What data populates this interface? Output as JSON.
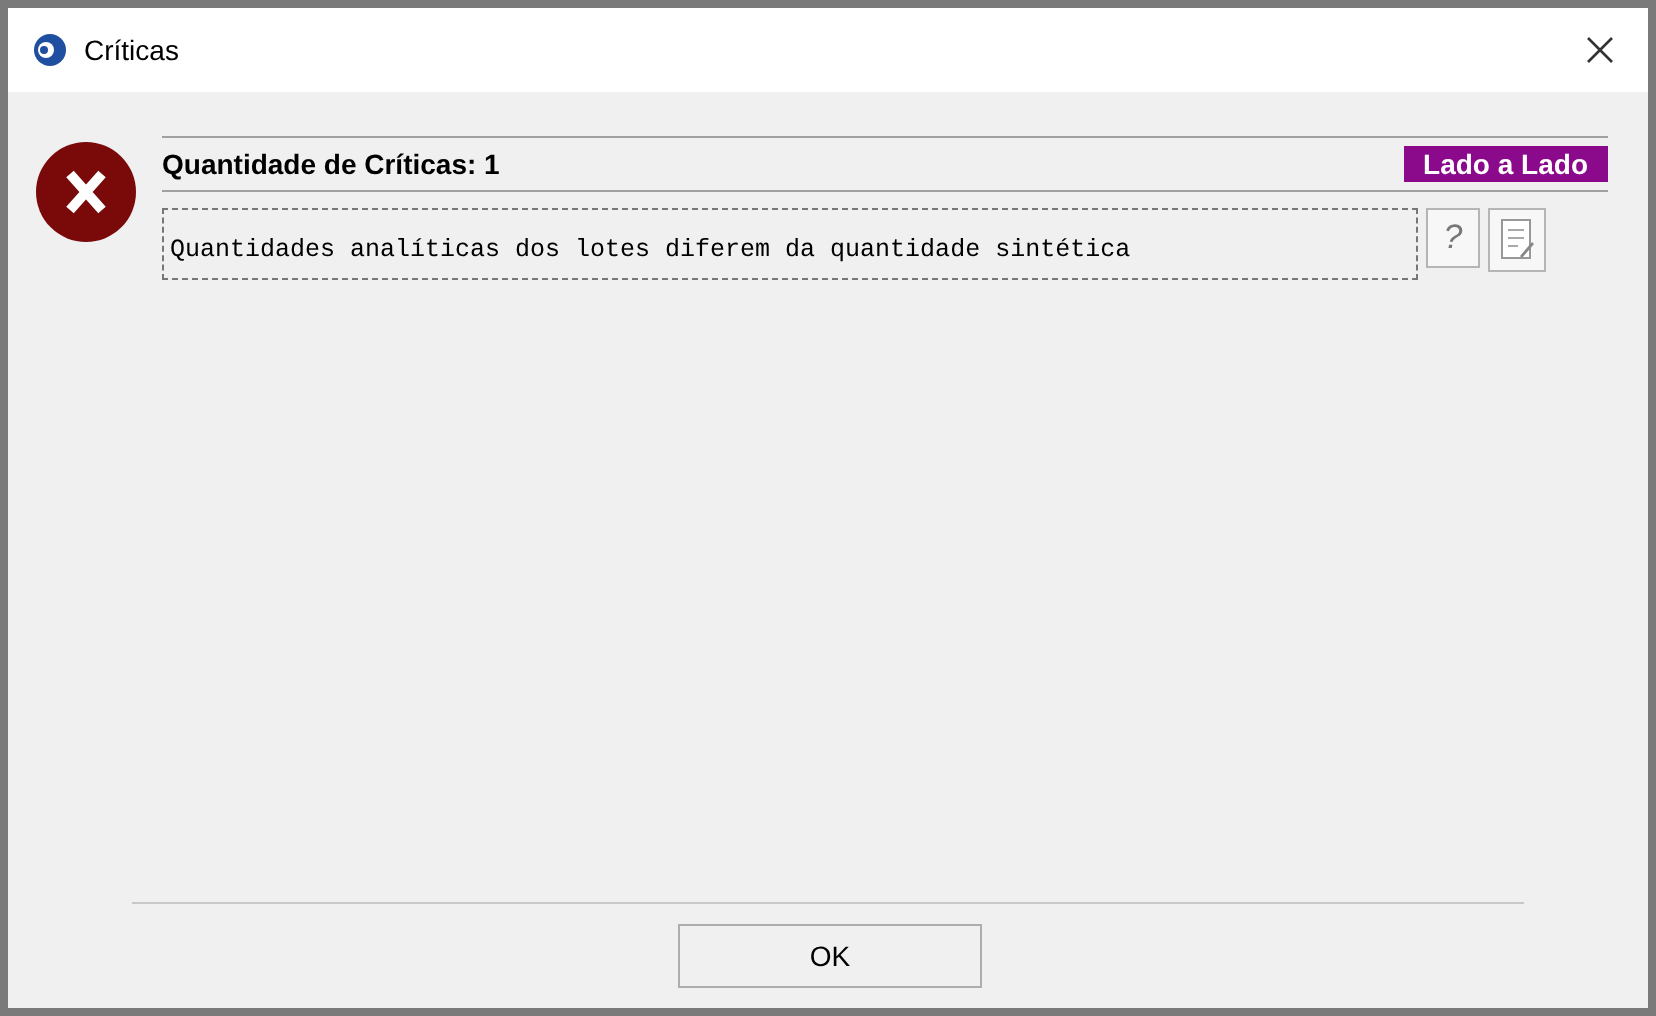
{
  "window": {
    "title": "Críticas"
  },
  "header": {
    "title": "Quantidade de Críticas: 1",
    "side_button": "Lado a Lado"
  },
  "messages": [
    {
      "text": "Quantidades analíticas dos lotes diferem da quantidade sintética",
      "help_button": "?"
    }
  ],
  "buttons": [
    "OK"
  ]
}
